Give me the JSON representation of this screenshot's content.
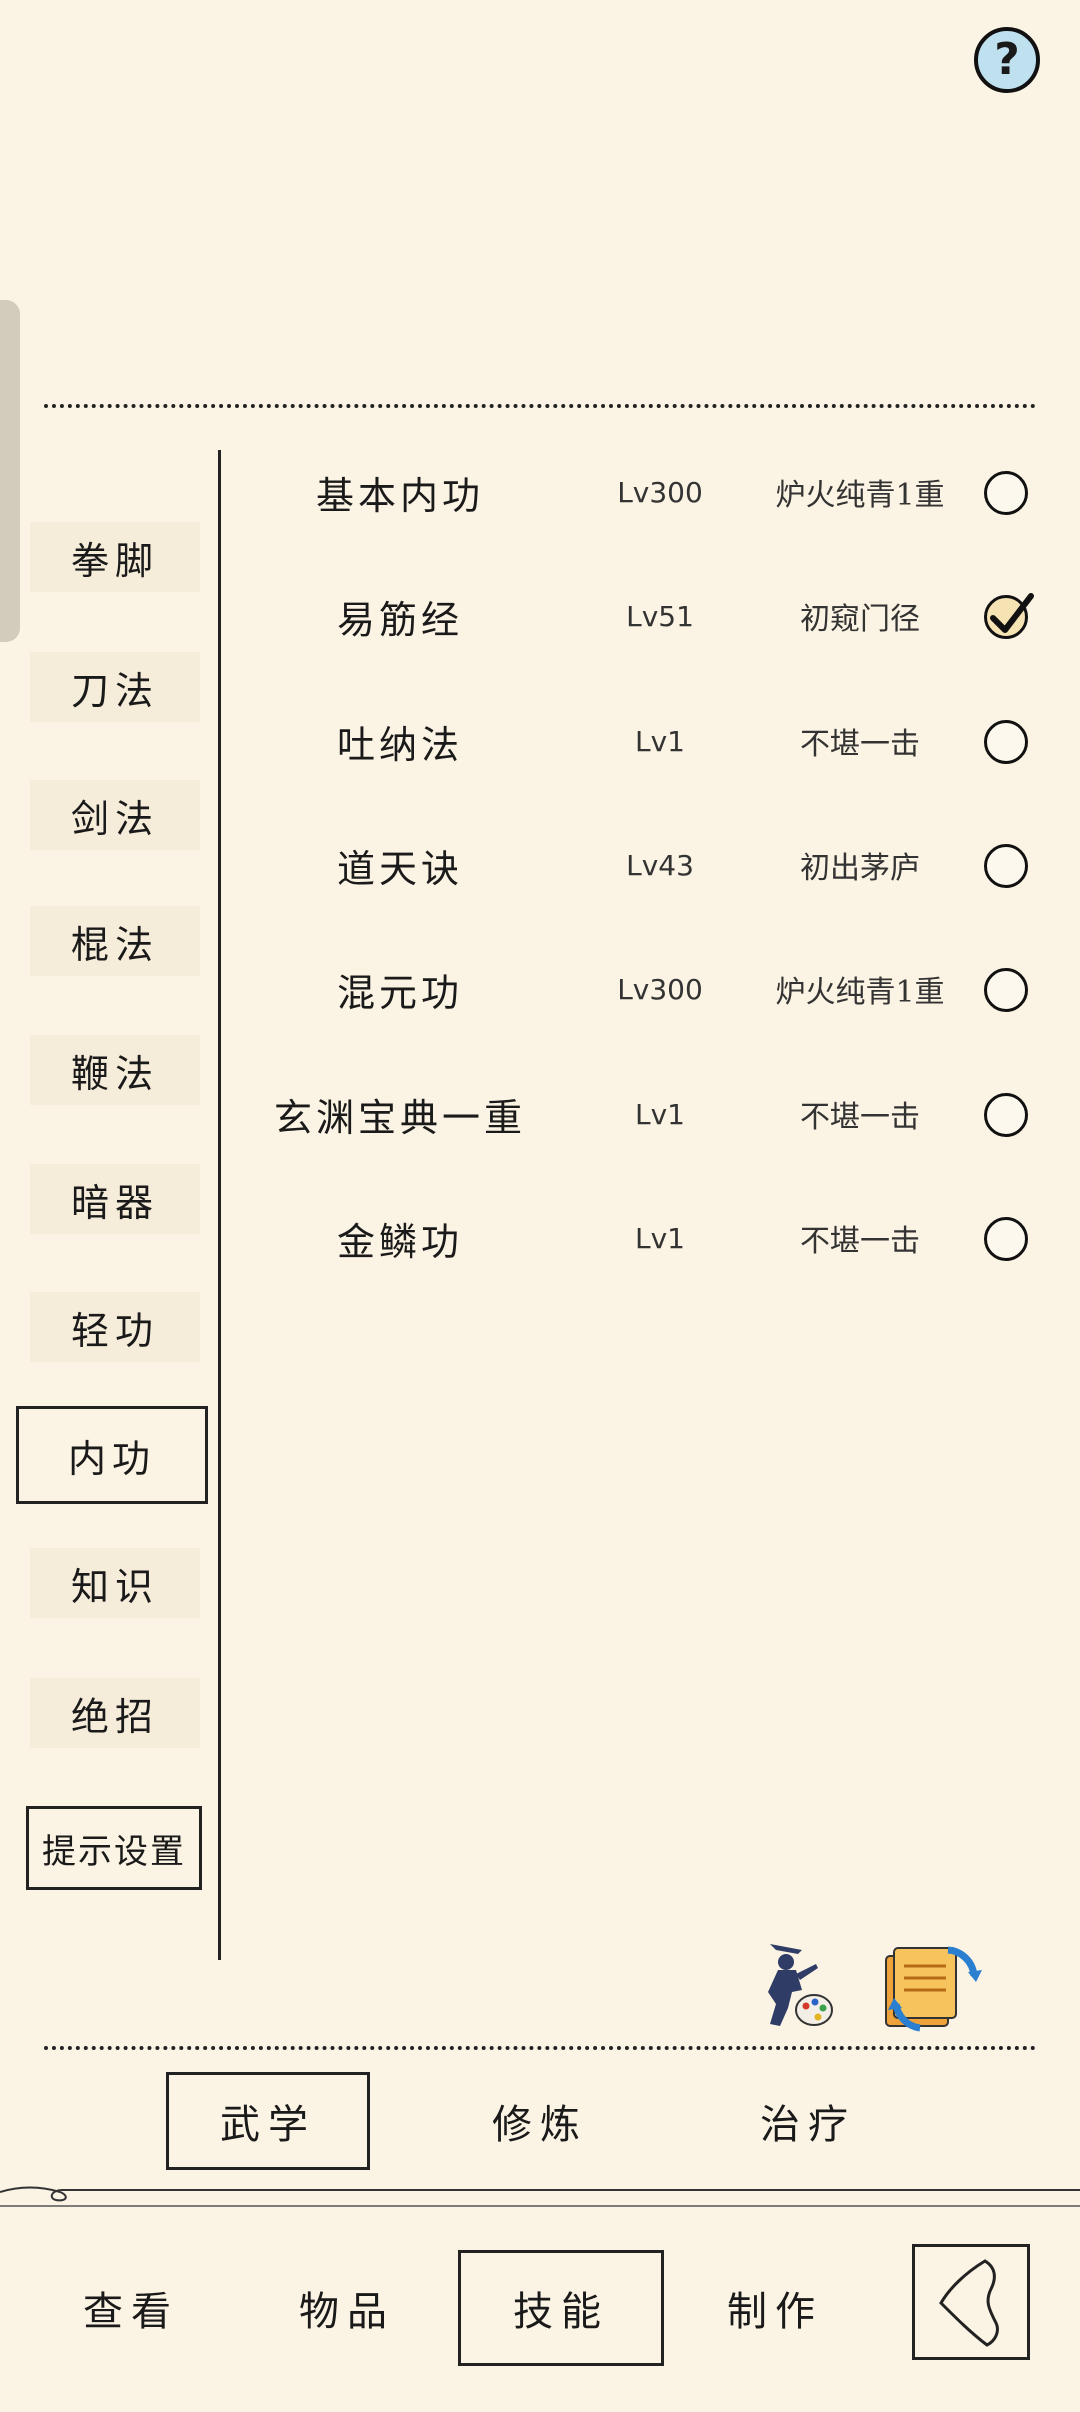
{
  "colors": {
    "background": "#fbf3e3",
    "ink": "#1a1a1a",
    "help_button_fill": "#bfe0ef",
    "checked_fill": "#f6e3b3"
  },
  "help_button": {
    "label": "?",
    "icon": "question-mark-icon"
  },
  "categories": [
    {
      "label": "拳脚",
      "active": false
    },
    {
      "label": "刀法",
      "active": false
    },
    {
      "label": "剑法",
      "active": false
    },
    {
      "label": "棍法",
      "active": false
    },
    {
      "label": "鞭法",
      "active": false
    },
    {
      "label": "暗器",
      "active": false
    },
    {
      "label": "轻功",
      "active": false
    },
    {
      "label": "内功",
      "active": true
    },
    {
      "label": "知识",
      "active": false
    },
    {
      "label": "绝招",
      "active": false
    }
  ],
  "tip_settings_label": "提示设置",
  "skills": [
    {
      "name": "基本内功",
      "level": "Lv300",
      "rank": "炉火纯青1重",
      "checked": false
    },
    {
      "name": "易筋经",
      "level": "Lv51",
      "rank": "初窥门径",
      "checked": true
    },
    {
      "name": "吐纳法",
      "level": "Lv1",
      "rank": "不堪一击",
      "checked": false
    },
    {
      "name": "道天诀",
      "level": "Lv43",
      "rank": "初出茅庐",
      "checked": false
    },
    {
      "name": "混元功",
      "level": "Lv300",
      "rank": "炉火纯青1重",
      "checked": false
    },
    {
      "name": "玄渊宝典一重",
      "level": "Lv1",
      "rank": "不堪一击",
      "checked": false
    },
    {
      "name": "金鳞功",
      "level": "Lv1",
      "rank": "不堪一击",
      "checked": false
    }
  ],
  "action_icons": [
    "fighter-palette-icon",
    "book-swap-icon"
  ],
  "sub_tabs": [
    {
      "label": "武学",
      "active": true
    },
    {
      "label": "修炼",
      "active": false
    },
    {
      "label": "治疗",
      "active": false
    }
  ],
  "nav_tabs": [
    {
      "label": "查看",
      "active": false
    },
    {
      "label": "物品",
      "active": false
    },
    {
      "label": "技能",
      "active": true
    },
    {
      "label": "制作",
      "active": false
    }
  ],
  "back_button": {
    "icon": "back-chevron-icon"
  }
}
